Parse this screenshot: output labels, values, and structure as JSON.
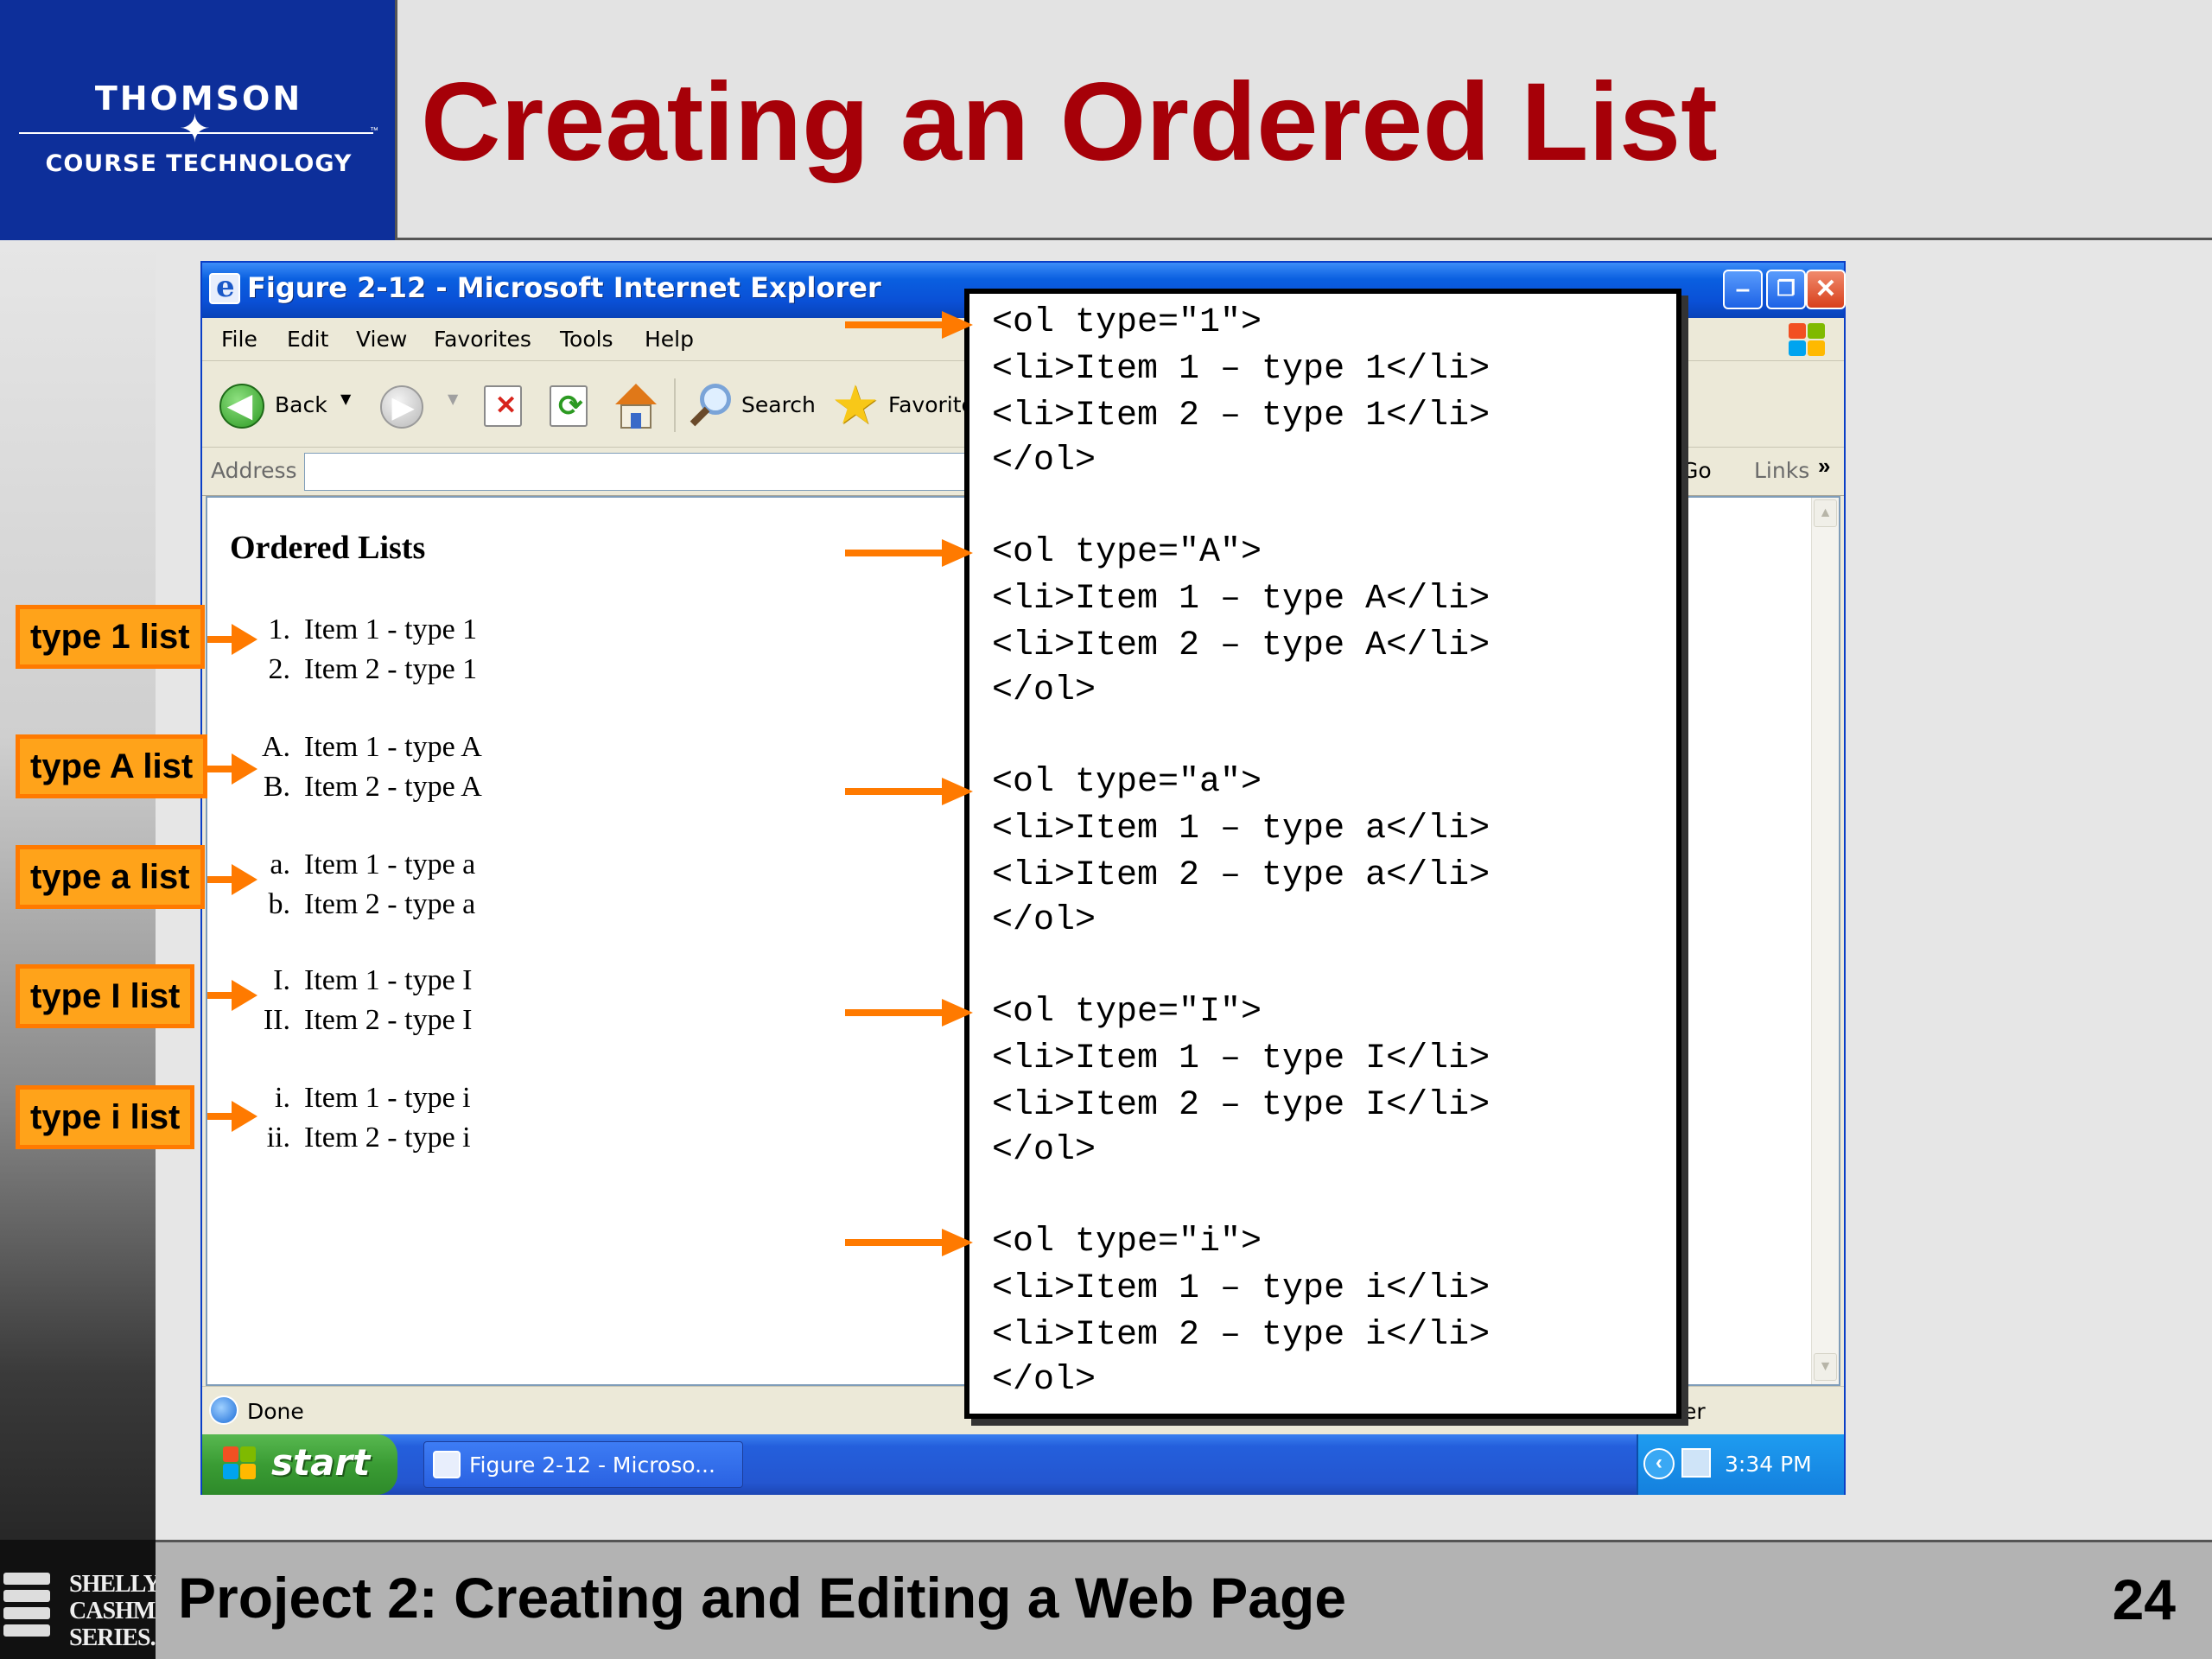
{
  "slide": {
    "logo_top": "THOMSON",
    "logo_bottom": "COURSE TECHNOLOGY",
    "logo_tm": "™",
    "title": "Creating an Ordered List",
    "footer": "Project 2: Creating and Editing a Web Page",
    "page_number": "24",
    "series_logo": [
      "SHELLY",
      "CASHMAN",
      "SERIES."
    ]
  },
  "browser": {
    "window_title": "Figure 2-12 - Microsoft Internet Explorer",
    "menu": [
      "File",
      "Edit",
      "View",
      "Favorites",
      "Tools",
      "Help"
    ],
    "toolbar": {
      "back": "Back",
      "search": "Search",
      "favorites": "Favorite"
    },
    "address_label": "Address",
    "address_value": "",
    "go": "Go",
    "links": "Links",
    "links_chevron": "»",
    "status": "Done",
    "status_right": "er"
  },
  "page": {
    "heading": "Ordered Lists",
    "lists": [
      {
        "markers": [
          "1.",
          "2."
        ],
        "items": [
          "Item 1 - type 1",
          "Item 2 - type 1"
        ]
      },
      {
        "markers": [
          "A.",
          "B."
        ],
        "items": [
          "Item 1 - type A",
          "Item 2 - type A"
        ]
      },
      {
        "markers": [
          "a.",
          "b."
        ],
        "items": [
          "Item 1 - type a",
          "Item 2 - type a"
        ]
      },
      {
        "markers": [
          "I.",
          "II."
        ],
        "items": [
          "Item 1 - type I",
          "Item 2 - type I"
        ]
      },
      {
        "markers": [
          "i.",
          "ii."
        ],
        "items": [
          "Item 1 - type i",
          "Item 2 - type i"
        ]
      }
    ]
  },
  "taskbar": {
    "start": "start",
    "task": "Figure 2-12 - Microso...",
    "clock": "3:34 PM"
  },
  "callouts": [
    "type 1 list",
    "type A list",
    "type a list",
    "type I list",
    "type i list"
  ],
  "code": [
    [
      "<ol type=\"1\">",
      "<li>Item 1 – type 1</li>",
      "<li>Item 2 – type 1</li>",
      "</ol>"
    ],
    [
      "<ol type=\"A\">",
      "<li>Item 1 – type A</li>",
      "<li>Item 2 – type A</li>",
      "</ol>"
    ],
    [
      "<ol type=\"a\">",
      "<li>Item 1 – type a</li>",
      "<li>Item 2 – type a</li>",
      "</ol>"
    ],
    [
      "<ol type=\"I\">",
      "<li>Item 1 – type I</li>",
      "<li>Item 2 – type I</li>",
      "</ol>"
    ],
    [
      "<ol type=\"i\">",
      "<li>Item 1 – type i</li>",
      "<li>Item 2 – type i</li>",
      "</ol>"
    ]
  ],
  "colors": {
    "title_red": "#a60008",
    "logo_blue": "#0d2f9a",
    "callout_orange": "#ffa31a",
    "arrow_orange": "#ff7a00"
  }
}
